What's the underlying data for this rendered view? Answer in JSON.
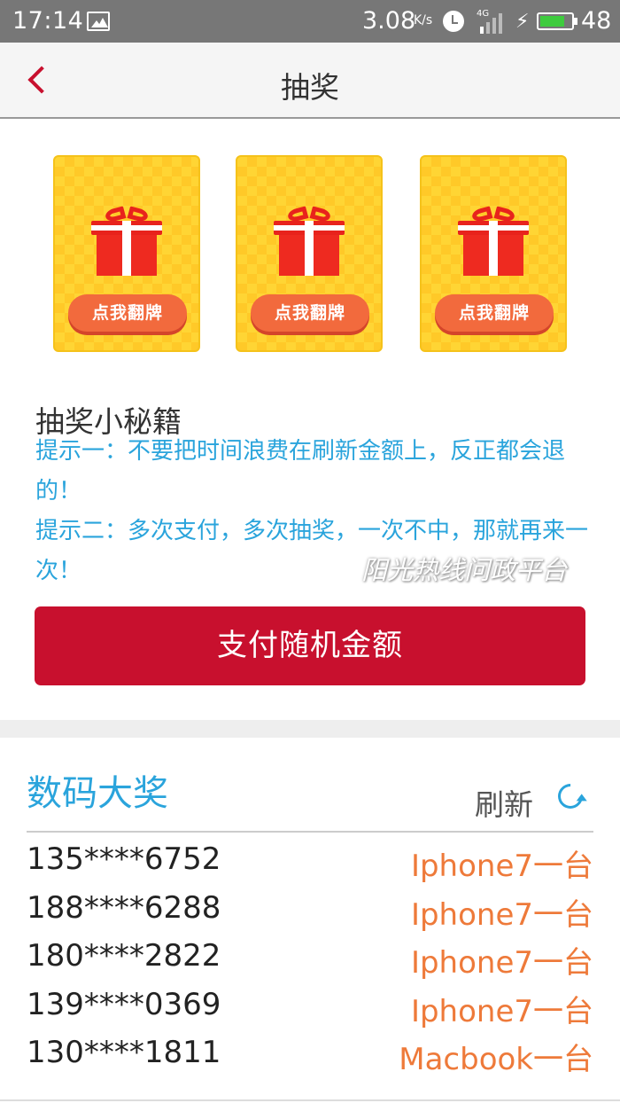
{
  "status_bar": {
    "time": "17:14",
    "speed": "3.08",
    "speed_unit": "K/s",
    "network": "4G",
    "battery_level": 0.8,
    "battery_percent": "48"
  },
  "header": {
    "title": "抽奖"
  },
  "cards": [
    {
      "button_label": "点我翻牌"
    },
    {
      "button_label": "点我翻牌"
    },
    {
      "button_label": "点我翻牌"
    }
  ],
  "tips": {
    "title": "抽奖小秘籍",
    "tip1": "提示一：不要把时间浪费在刷新金额上，反正都会退的！",
    "tip2": "提示二：多次支付，多次抽奖，一次不中，那就再来一次！"
  },
  "watermark": "阳光热线问政平台",
  "pay_button": "支付随机金额",
  "winners": {
    "title": "数码大奖",
    "refresh_label": "刷新",
    "rows": [
      {
        "phone": "135****6752",
        "prize": "Iphone7一台"
      },
      {
        "phone": "188****6288",
        "prize": "Iphone7一台"
      },
      {
        "phone": "180****2822",
        "prize": "Iphone7一台"
      },
      {
        "phone": "139****0369",
        "prize": "Iphone7一台"
      },
      {
        "phone": "130****1811",
        "prize": "Macbook一台"
      }
    ]
  },
  "colors": {
    "accent_red": "#c8102e",
    "tip_blue": "#2aa4dc",
    "prize_orange": "#ee7a3a",
    "card_yellow": "#ffd534"
  }
}
